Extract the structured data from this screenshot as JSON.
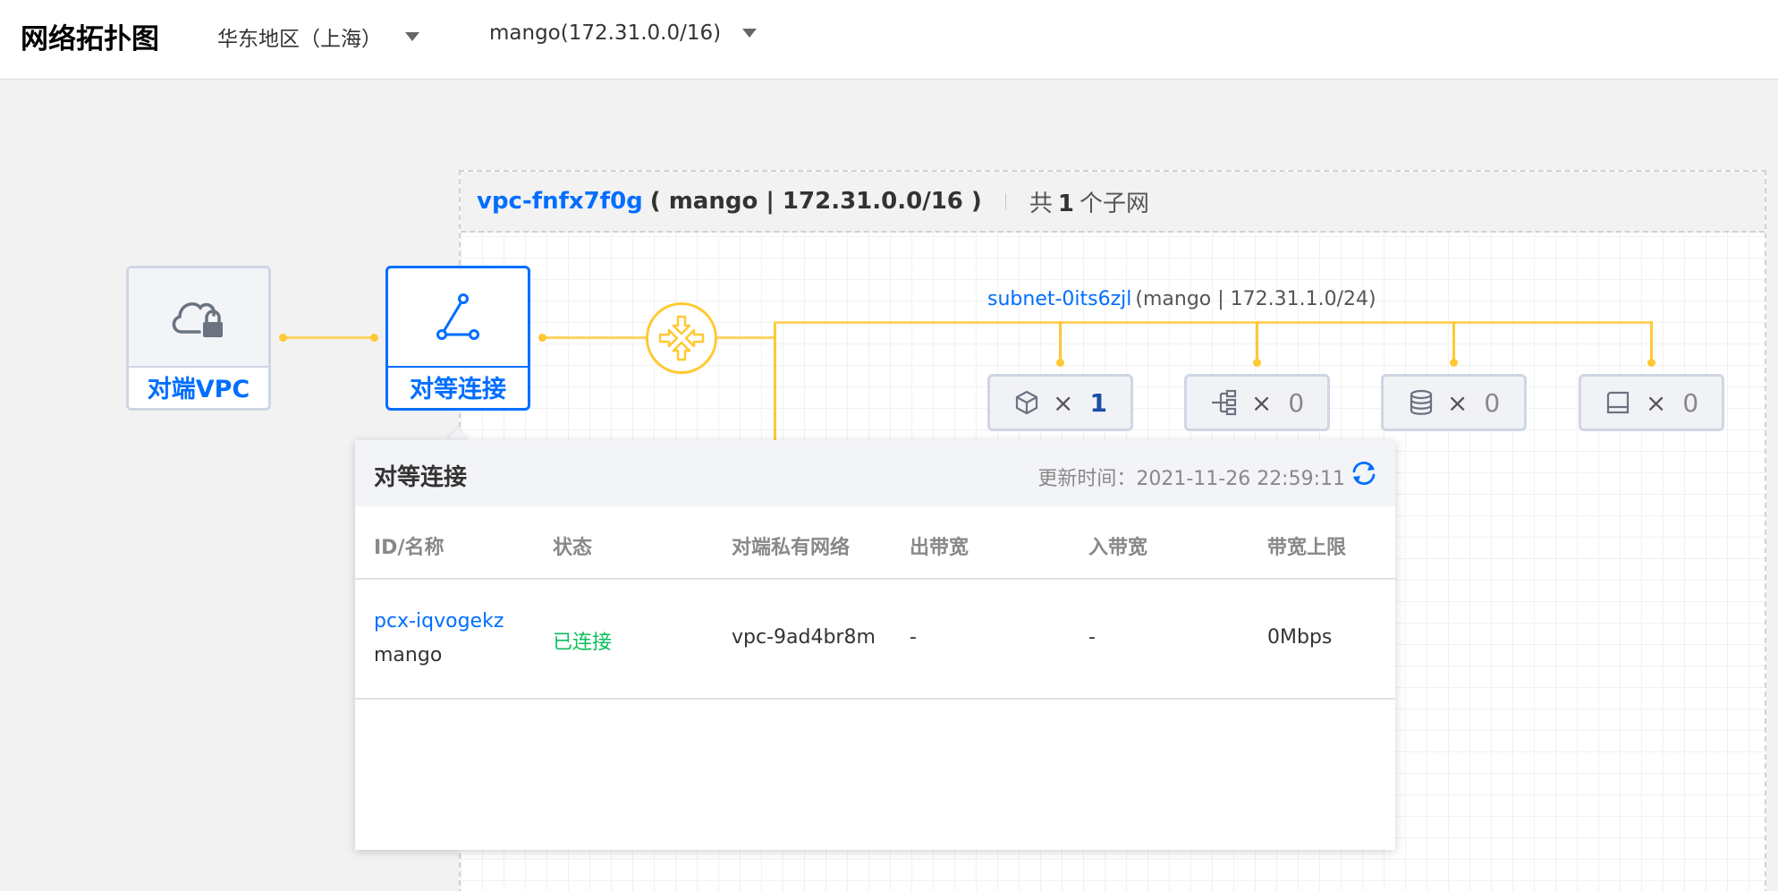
{
  "header": {
    "title": "网络拓扑图",
    "region": "华东地区（上海）",
    "vpc_select": "mango(172.31.0.0/16)"
  },
  "vpc": {
    "id": "vpc-fnfx7f0g",
    "meta": "( mango | 172.31.0.0/16 )",
    "subnet_prefix": "共",
    "subnet_count": "1",
    "subnet_suffix": "个子网"
  },
  "nodes": {
    "peer_vpc_label": "对端VPC",
    "peering_label": "对等连接"
  },
  "subnet": {
    "id": "subnet-0its6zjl",
    "meta": "(mango | 172.31.1.0/24)",
    "resources": [
      {
        "icon": "cube-icon",
        "x": "×",
        "count": "1"
      },
      {
        "icon": "tree-icon",
        "x": "×",
        "count": "0"
      },
      {
        "icon": "database-icon",
        "x": "×",
        "count": "0"
      },
      {
        "icon": "disk-icon",
        "x": "×",
        "count": "0"
      }
    ]
  },
  "popup": {
    "title": "对等连接",
    "update_time": "更新时间：2021-11-26 22:59:11",
    "columns": [
      "ID/名称",
      "状态",
      "对端私有网络",
      "出带宽",
      "入带宽",
      "带宽上限"
    ],
    "rows": [
      {
        "id": "pcx-iqvogekz",
        "name": "mango",
        "status": "已连接",
        "peer_vpc": "vpc-9ad4br8m",
        "out_bw": "-",
        "in_bw": "-",
        "bw_limit": "0Mbps"
      }
    ]
  },
  "colors": {
    "accent": "#006eff",
    "line": "#ffc933",
    "status_ok": "#0abf5b"
  }
}
